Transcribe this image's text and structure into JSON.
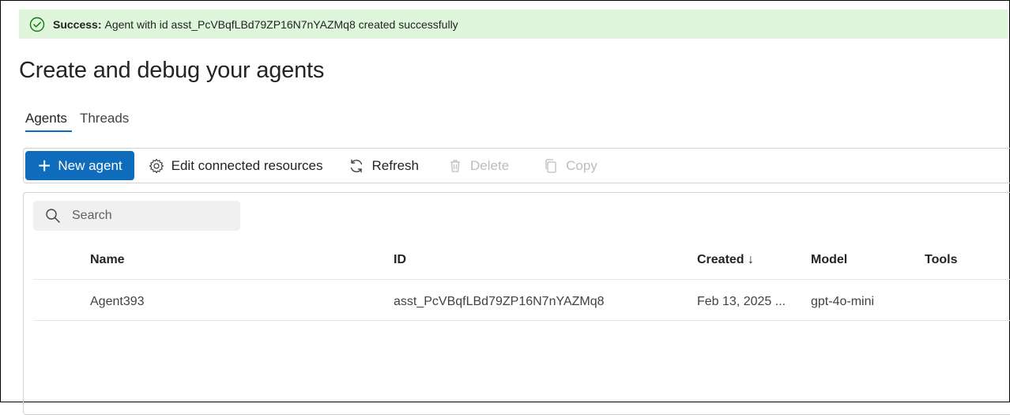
{
  "banner": {
    "title": "Success:",
    "message": "Agent with id asst_PcVBqfLBd79ZP16N7nYAZMq8 created successfully",
    "color": "#dff6dd",
    "icon": "check-circle-icon"
  },
  "page": {
    "title": "Create and debug your agents"
  },
  "tabs": [
    {
      "label": "Agents",
      "active": true
    },
    {
      "label": "Threads",
      "active": false
    }
  ],
  "toolbar": {
    "new_agent": "New agent",
    "edit_resources": "Edit connected resources",
    "refresh": "Refresh",
    "delete": "Delete",
    "copy": "Copy",
    "accent": "#0f6cbd"
  },
  "search": {
    "placeholder": "Search"
  },
  "table": {
    "columns": [
      "Name",
      "ID",
      "Created ↓",
      "Model",
      "Tools"
    ],
    "rows": [
      [
        "Agent393",
        "asst_PcVBqfLBd79ZP16N7nYAZMq8",
        "Feb 13, 2025 ...",
        "gpt-4o-mini",
        ""
      ]
    ]
  }
}
